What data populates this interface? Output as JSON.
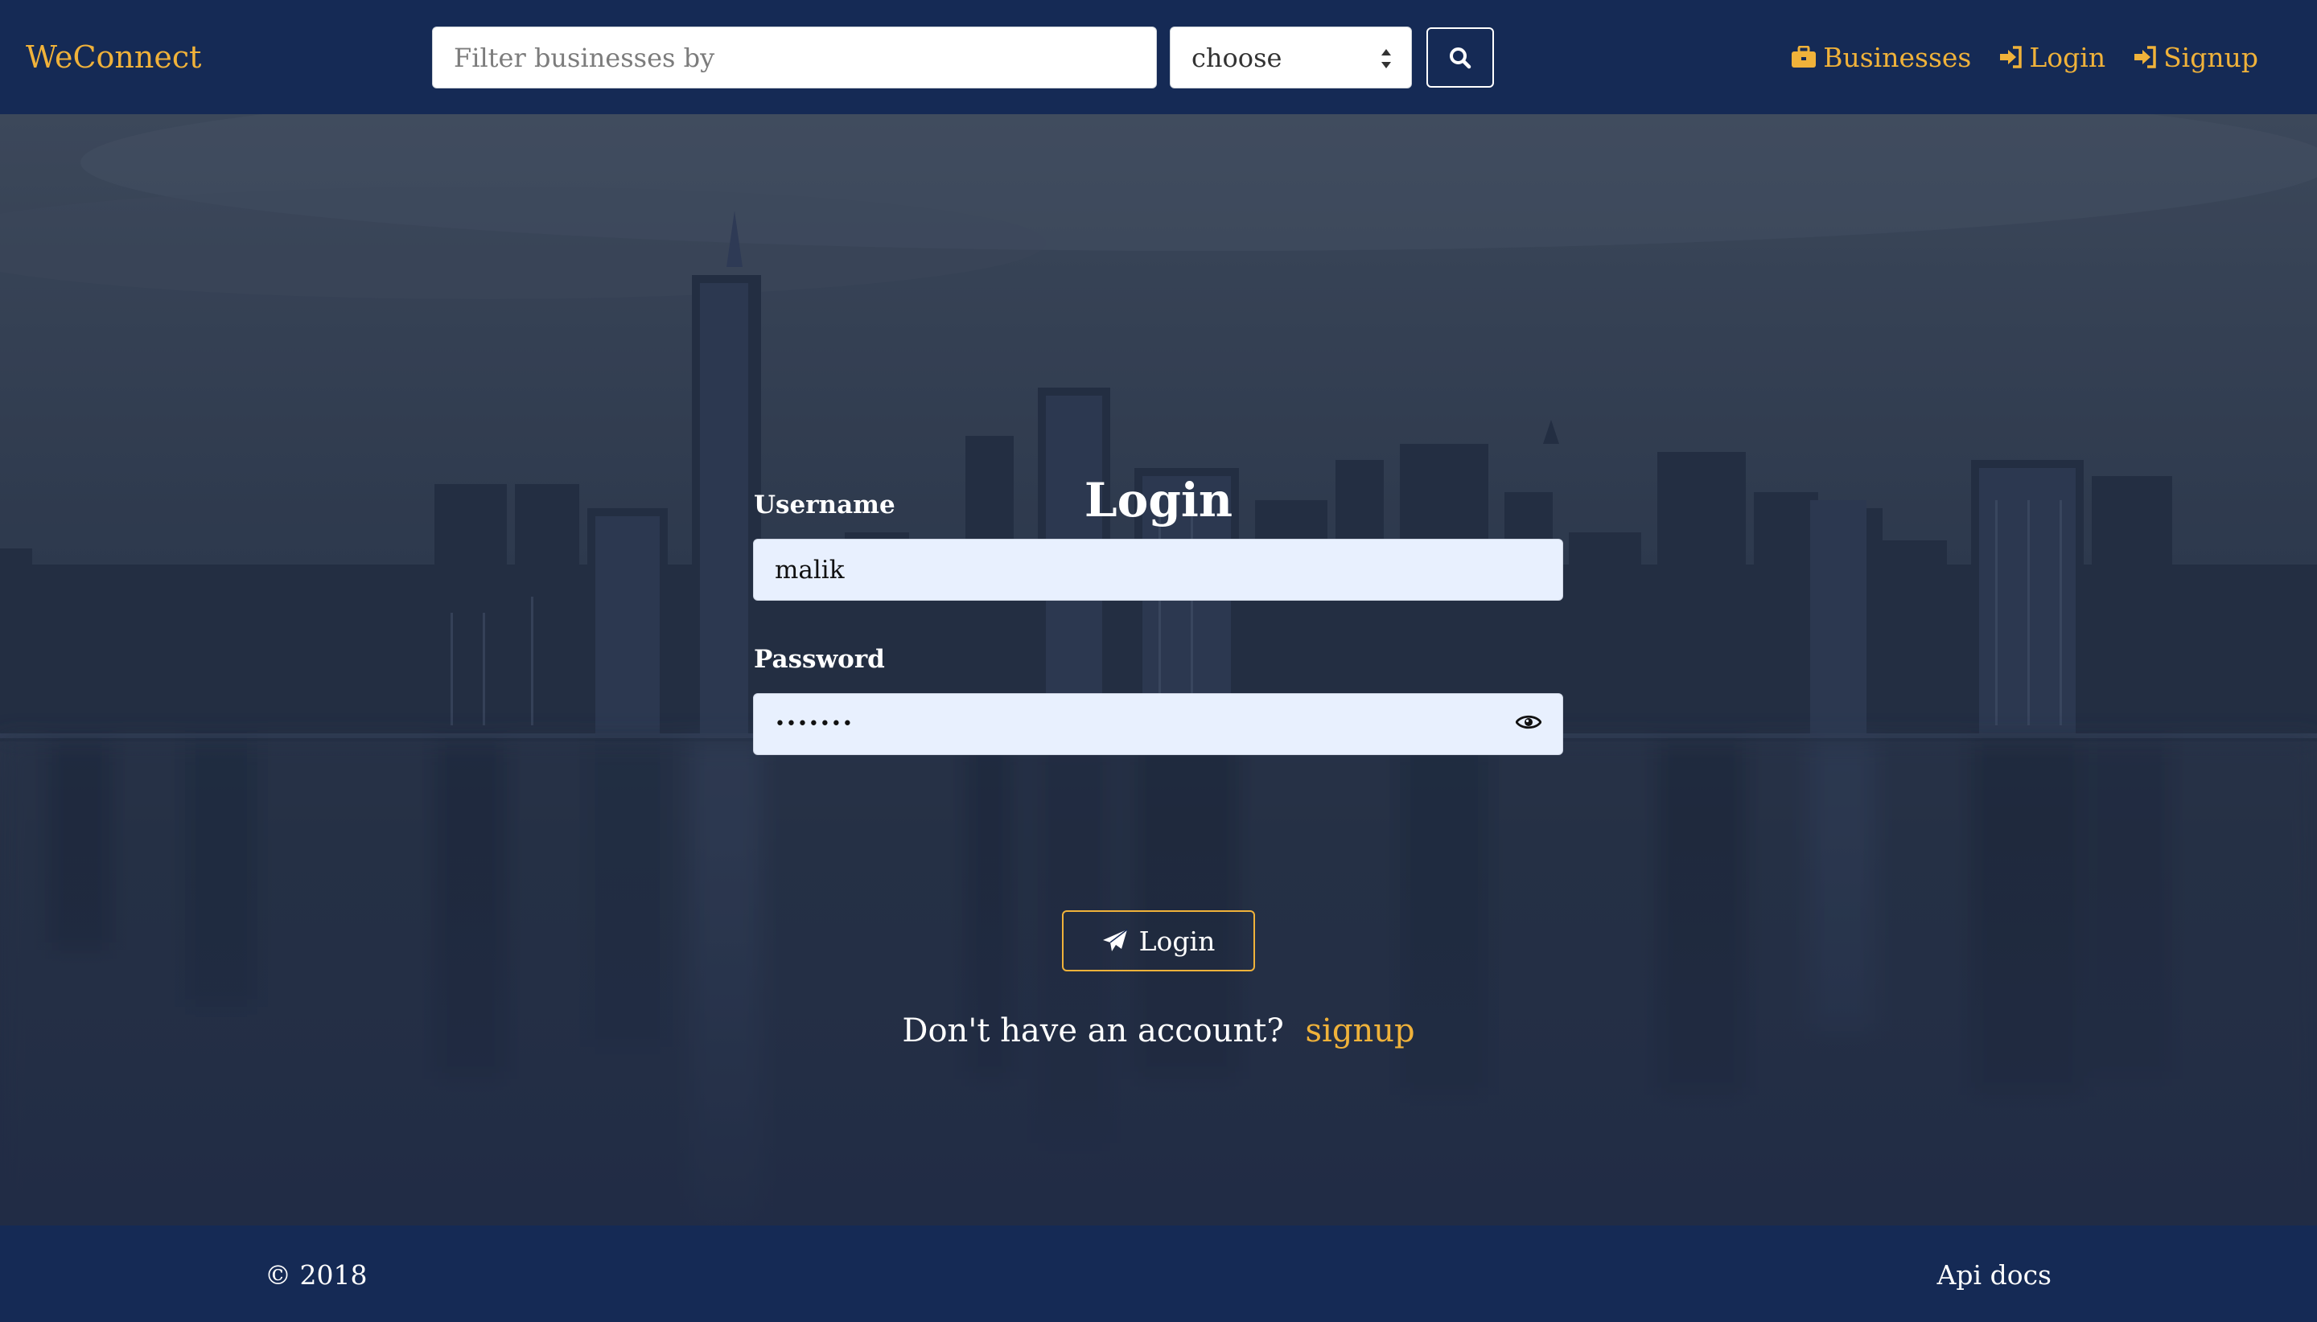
{
  "app": {
    "brand": "WeConnect"
  },
  "navbar": {
    "search_placeholder": "Filter businesses by",
    "filter_select_value": "choose",
    "links": [
      {
        "label": "Businesses",
        "icon": "briefcase-icon"
      },
      {
        "label": "Login",
        "icon": "sign-in-icon"
      },
      {
        "label": "Signup",
        "icon": "sign-in-icon"
      }
    ]
  },
  "login_form": {
    "title": "Login",
    "username_label": "Username",
    "username_value": "malik",
    "password_label": "Password",
    "password_value": "•••••••",
    "submit_label": "Login",
    "signup_prompt": "Don't have an account?",
    "signup_link": "signup"
  },
  "footer": {
    "copyright": "© 2018",
    "api_docs": "Api docs"
  },
  "colors": {
    "navbar_bg": "#152a55",
    "accent": "#f0b23a",
    "input_bg": "#e8f0fe"
  }
}
